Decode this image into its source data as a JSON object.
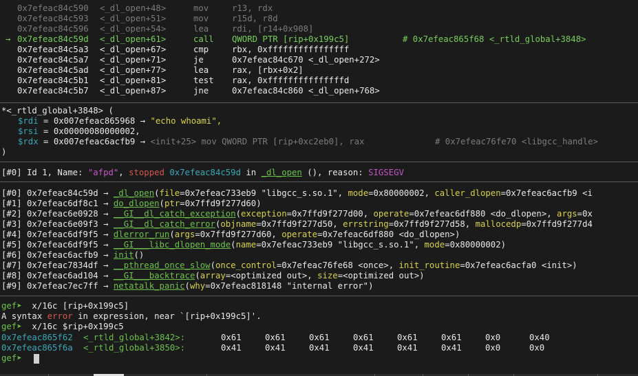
{
  "disasm": [
    {
      "addr": "0x7efeac84c590",
      "sym": "<_dl_open+48>",
      "mn": "mov",
      "op": "r13, rdx",
      "comment": "",
      "state": "past"
    },
    {
      "addr": "0x7efeac84c593",
      "sym": "<_dl_open+51>",
      "mn": "mov",
      "op": "r15d, r8d",
      "comment": "",
      "state": "past"
    },
    {
      "addr": "0x7efeac84c596",
      "sym": "<_dl_open+54>",
      "mn": "lea",
      "op": "rdi, [r14+0x908]",
      "comment": "",
      "state": "past"
    },
    {
      "addr": "0x7efeac84c59d",
      "sym": "<_dl_open+61>",
      "mn": "call",
      "op": "QWORD PTR [rip+0x199c5]",
      "comment": "# 0x7efeac865f68 <_rtld_global+3848>",
      "state": "current",
      "marker": "→"
    },
    {
      "addr": "0x7efeac84c5a3",
      "sym": "<_dl_open+67>",
      "mn": "cmp",
      "op": "rbx, 0xffffffffffffffff",
      "comment": "",
      "state": "next"
    },
    {
      "addr": "0x7efeac84c5a7",
      "sym": "<_dl_open+71>",
      "mn": "je",
      "op": "0x7efeac84c670 <_dl_open+272>",
      "comment": "",
      "state": "next"
    },
    {
      "addr": "0x7efeac84c5ad",
      "sym": "<_dl_open+77>",
      "mn": "lea",
      "op": "rax, [rbx+0x2]",
      "comment": "",
      "state": "next"
    },
    {
      "addr": "0x7efeac84c5b1",
      "sym": "<_dl_open+81>",
      "mn": "test",
      "op": "rax, 0xfffffffffffffffd",
      "comment": "",
      "state": "next"
    },
    {
      "addr": "0x7efeac84c5b7",
      "sym": "<_dl_open+87>",
      "mn": "jne",
      "op": "0x7efeac84c860 <_dl_open+768>",
      "comment": "",
      "state": "next"
    }
  ],
  "call_args": {
    "header": "*<_rtld_global+3848> (",
    "closer": ")",
    "rdi": {
      "reg": "$rdi",
      "eq": " = 0x007efeac865968 → ",
      "val": "\"echo whoami\","
    },
    "rsi": {
      "reg": "$rsi",
      "eq": " = 0x00000080000002,"
    },
    "rdx": {
      "reg": "$rdx",
      "eq": " = 0x007efeac6acfb9 → ",
      "val": "<init+25> mov QWORD PTR [rip+0xc2eb0], rax",
      "comment": "# 0x7efeac76fe70 <libgcc_handle>"
    }
  },
  "thread": {
    "prefix": "[#0] Id 1, Name: ",
    "name": "\"afpd\"",
    "sep1": ", ",
    "state": "stopped",
    "addr": " 0x7efeac84c59d",
    "in": " in ",
    "func": "_dl_open",
    "rest": " (), reason: ",
    "reason": "SIGSEGV"
  },
  "frames": [
    {
      "idx": "[#0]",
      "addr": " 0x7efeac84c59d → ",
      "func": "_dl_open",
      "args": [
        [
          "file",
          "0x7efeac733eb9 \"libgcc_s.so.1\""
        ],
        [
          "mode",
          "0x80000002"
        ],
        [
          "caller_dlopen",
          "0x7efeac6acfb9 <i"
        ]
      ],
      "close": ""
    },
    {
      "idx": "[#1]",
      "addr": " 0x7efeac6df8c1 → ",
      "func": "do_dlopen",
      "args": [
        [
          "ptr",
          "0x7ffd9f277d60"
        ]
      ],
      "close": ")"
    },
    {
      "idx": "[#2]",
      "addr": " 0x7efeac6e0928 → ",
      "func": "__GI__dl_catch_exception",
      "args": [
        [
          "exception",
          "0x7ffd9f277d00"
        ],
        [
          "operate",
          "0x7efeac6df880 <do_dlopen>"
        ],
        [
          "args",
          "0x"
        ]
      ],
      "close": ""
    },
    {
      "idx": "[#3]",
      "addr": " 0x7efeac6e09f3 → ",
      "func": "__GI__dl_catch_error",
      "args": [
        [
          "objname",
          "0x7ffd9f277d50"
        ],
        [
          "errstring",
          "0x7ffd9f277d58"
        ],
        [
          "mallocedp",
          "0x7ffd9f277d4"
        ]
      ],
      "close": ""
    },
    {
      "idx": "[#4]",
      "addr": " 0x7efeac6df9f5 → ",
      "func": "dlerror_run",
      "args": [
        [
          "args",
          "0x7ffd9f277d60"
        ],
        [
          "operate",
          "0x7efeac6df880 <do_dlopen>"
        ]
      ],
      "close": ")"
    },
    {
      "idx": "[#5]",
      "addr": " 0x7efeac6df9f5 → ",
      "func": "__GI___libc_dlopen_mode",
      "args": [
        [
          "name",
          "0x7efeac733eb9 \"libgcc_s.so.1\""
        ],
        [
          "mode",
          "0x80000002"
        ]
      ],
      "close": ")"
    },
    {
      "idx": "[#6]",
      "addr": " 0x7efeac6acfb9 → ",
      "func": "init",
      "args": [],
      "close": ")"
    },
    {
      "idx": "[#7]",
      "addr": " 0x7efeac7834df → ",
      "func": "__pthread_once_slow",
      "args": [
        [
          "once_control",
          "0x7efeac76fe68 <once>"
        ],
        [
          "init_routine",
          "0x7efeac6acfa0 <init>"
        ]
      ],
      "close": ")"
    },
    {
      "idx": "[#8]",
      "addr": " 0x7efeac6ad104 → ",
      "func": "__GI___backtrace",
      "args": [
        [
          "array",
          "<optimized out>"
        ],
        [
          "size",
          "<optimized out>"
        ]
      ],
      "close": ")"
    },
    {
      "idx": "[#9]",
      "addr": " 0x7efeac7ec7ff → ",
      "func": "netatalk_panic",
      "args": [
        [
          "why",
          "0x7efeac818148 \"internal error\""
        ]
      ],
      "close": ")"
    }
  ],
  "console": {
    "prompt": "gef➤ ",
    "cmd1": " x/16c [rip+0x199c5]",
    "err_a": "A syntax ",
    "err_word": "error",
    "err_b": " in expression, near `[rip+0x199c5]'.",
    "cmd2": " x/16c $rip+0x199c5",
    "rows": [
      {
        "addr": "0x7efeac865f62",
        "sym": "<_rtld_global+3842>:",
        "vals": [
          "0x61",
          "0x61",
          "0x61",
          "0x61",
          "0x61",
          "0x61",
          "0x0",
          "0x40"
        ]
      },
      {
        "addr": "0x7efeac865f6a",
        "sym": "<_rtld_global+3850>:",
        "vals": [
          "0x41",
          "0x41",
          "0x41",
          "0x41",
          "0x41",
          "0x41",
          "0x0",
          "0x0"
        ]
      }
    ]
  },
  "colors": {
    "bg": "#1b1b1b",
    "green": "#78d05a",
    "cyan": "#3aa8b8",
    "yellow": "#d8d24a",
    "magenta": "#c455c7",
    "red": "#d4584f",
    "dim": "#7b7b7b"
  }
}
